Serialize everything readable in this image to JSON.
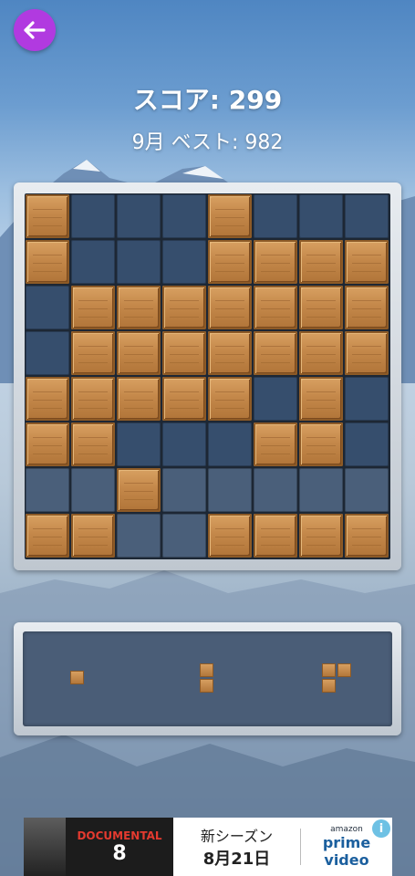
{
  "header": {
    "back_icon": "arrow-left-icon",
    "score_text": "スコア: 299",
    "best_text": "9月 ベスト: 982"
  },
  "board": {
    "rows": 8,
    "cols": 8,
    "grid": [
      "10001000",
      "10001111",
      "01111111",
      "01111111",
      "11111010",
      "11000110",
      "00100000",
      "11001111"
    ]
  },
  "tray": {
    "pieces": [
      {
        "name": "piece-single",
        "cells": [
          [
            0,
            0
          ]
        ]
      },
      {
        "name": "piece-vertical-2",
        "cells": [
          [
            0,
            0
          ],
          [
            1,
            0
          ]
        ]
      },
      {
        "name": "piece-corner-3",
        "cells": [
          [
            0,
            0
          ],
          [
            0,
            1
          ],
          [
            1,
            0
          ]
        ]
      }
    ]
  },
  "ad": {
    "logo_top": "DOCUMENTAL",
    "logo_num": "8",
    "season_text": "新シーズン",
    "date_text": "8月21日",
    "brand_small": "amazon",
    "brand_text": "prime video",
    "info_icon": "info-icon",
    "info_glyph": "i"
  },
  "colors": {
    "accent": "#b13ae0",
    "wood": "#c4884a",
    "empty_cell": "#3e5a7d",
    "frame": "#d8dde3"
  }
}
